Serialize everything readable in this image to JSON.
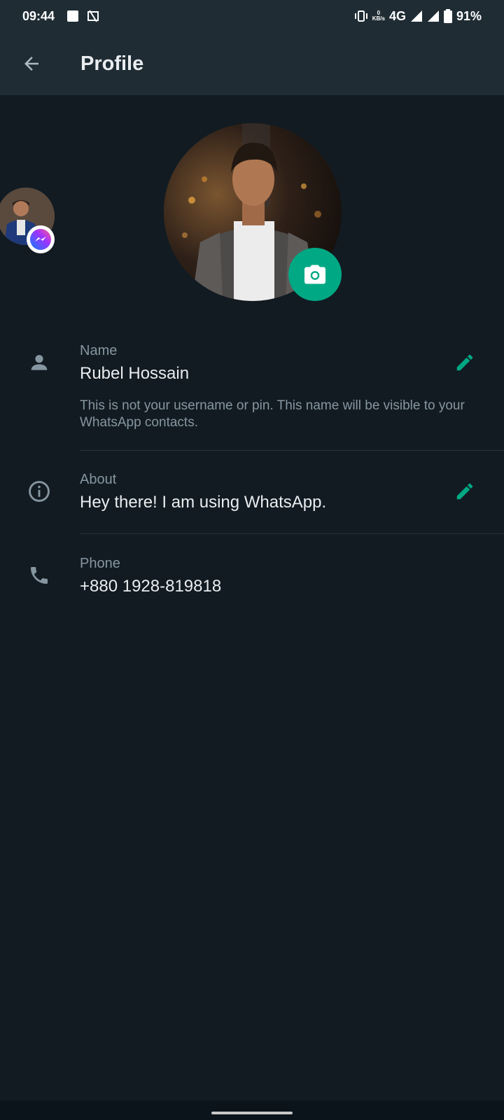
{
  "status_bar": {
    "time": "09:44",
    "network": "4G",
    "kbs_top": "0",
    "kbs_bottom": "KB/s",
    "battery": "91%"
  },
  "app_bar": {
    "title": "Profile",
    "back_icon": "arrow-back-icon"
  },
  "profile": {
    "camera_icon": "camera-icon"
  },
  "fields": {
    "name": {
      "label": "Name",
      "value": "Rubel Hossain",
      "hint": "This is not your username or pin. This name will be visible to your WhatsApp contacts.",
      "icon": "person-icon",
      "edit_icon": "pencil-icon"
    },
    "about": {
      "label": "About",
      "value": "Hey there! I am using WhatsApp.",
      "icon": "info-icon",
      "edit_icon": "pencil-icon"
    },
    "phone": {
      "label": "Phone",
      "value": "+880 1928-819818",
      "icon": "phone-icon"
    }
  },
  "colors": {
    "background": "#121b22",
    "app_bar": "#1f2c34",
    "accent": "#00a884",
    "secondary_text": "#8696a0",
    "primary_text": "#e9edef"
  }
}
